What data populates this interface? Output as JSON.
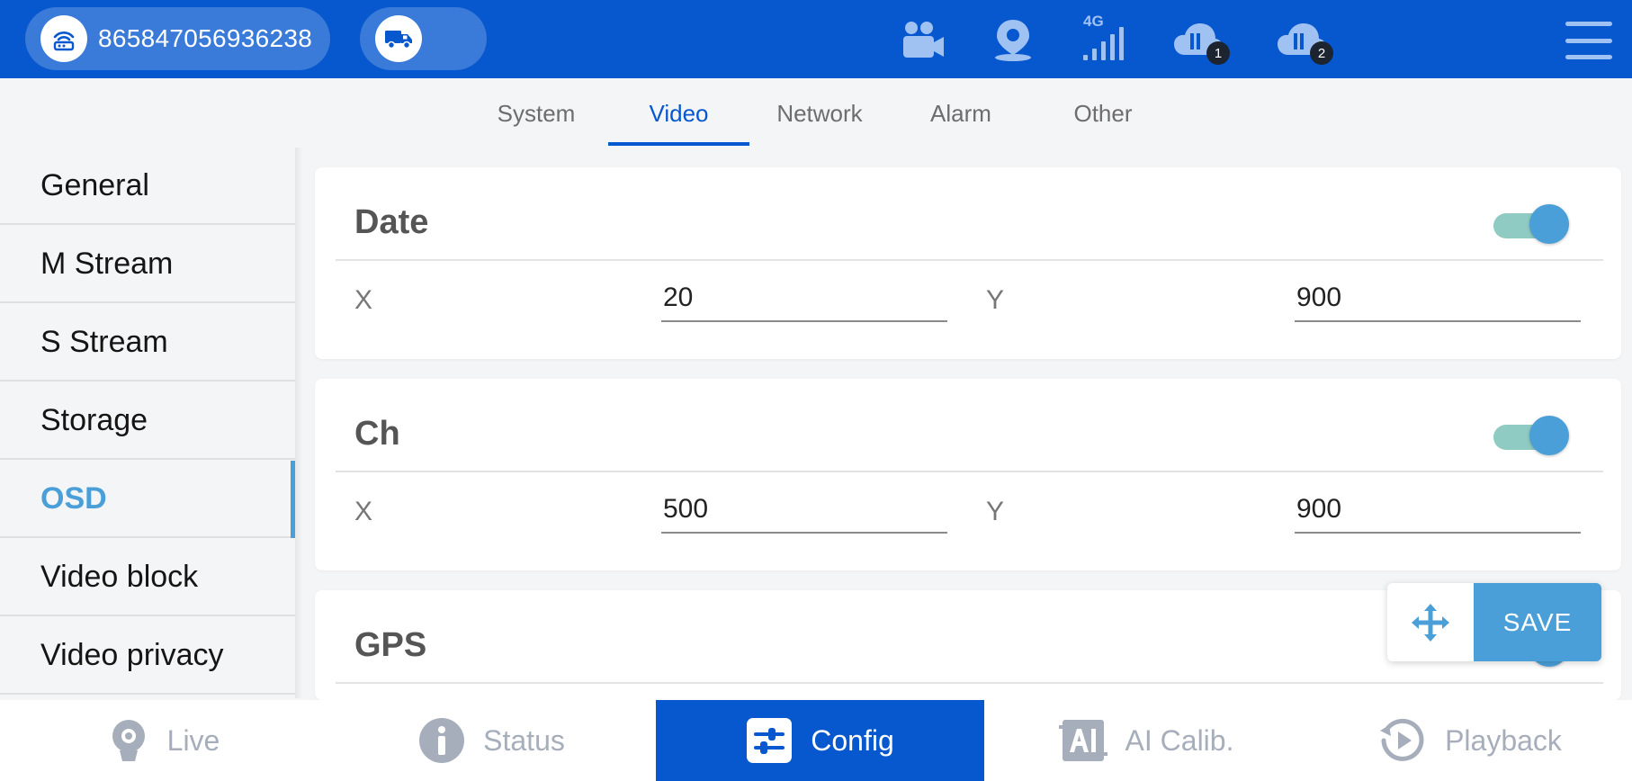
{
  "topbar": {
    "device_id": "865847056936238",
    "device_icon": "router-icon",
    "vehicle_icon": "truck-icon",
    "status_icons": [
      {
        "name": "camera-icon"
      },
      {
        "name": "location-icon"
      },
      {
        "name": "cellular-4g-icon",
        "label": "4G"
      },
      {
        "name": "cloud-server-1-icon",
        "badge": "1"
      },
      {
        "name": "cloud-server-2-icon",
        "badge": "2"
      }
    ],
    "menu_icon": "hamburger-menu-icon"
  },
  "tabs": [
    {
      "label": "System"
    },
    {
      "label": "Video",
      "active": true
    },
    {
      "label": "Network"
    },
    {
      "label": "Alarm"
    },
    {
      "label": "Other"
    }
  ],
  "sidebar": {
    "items": [
      {
        "label": "General"
      },
      {
        "label": "M Stream"
      },
      {
        "label": "S Stream"
      },
      {
        "label": "Storage"
      },
      {
        "label": "OSD",
        "active": true
      },
      {
        "label": "Video block"
      },
      {
        "label": "Video privacy"
      }
    ]
  },
  "osd": {
    "date": {
      "title": "Date",
      "enabled": true,
      "x_label": "X",
      "x_value": "20",
      "y_label": "Y",
      "y_value": "900"
    },
    "ch": {
      "title": "Ch",
      "enabled": true,
      "x_label": "X",
      "x_value": "500",
      "y_label": "Y",
      "y_value": "900"
    },
    "gps": {
      "title": "GPS"
    }
  },
  "actions": {
    "move_icon": "move-arrows-icon",
    "save_label": "SAVE"
  },
  "bottom_nav": [
    {
      "label": "Live",
      "icon": "webcam-icon"
    },
    {
      "label": "Status",
      "icon": "info-icon"
    },
    {
      "label": "Config",
      "icon": "sliders-icon",
      "active": true
    },
    {
      "label": "AI Calib.",
      "icon": "ai-icon"
    },
    {
      "label": "Playback",
      "icon": "playback-icon"
    }
  ],
  "colors": {
    "primary": "#0757cf",
    "accent": "#4a9fd8",
    "toggle_track": "#8fcbc3",
    "inactive_nav": "#a7aebb"
  }
}
